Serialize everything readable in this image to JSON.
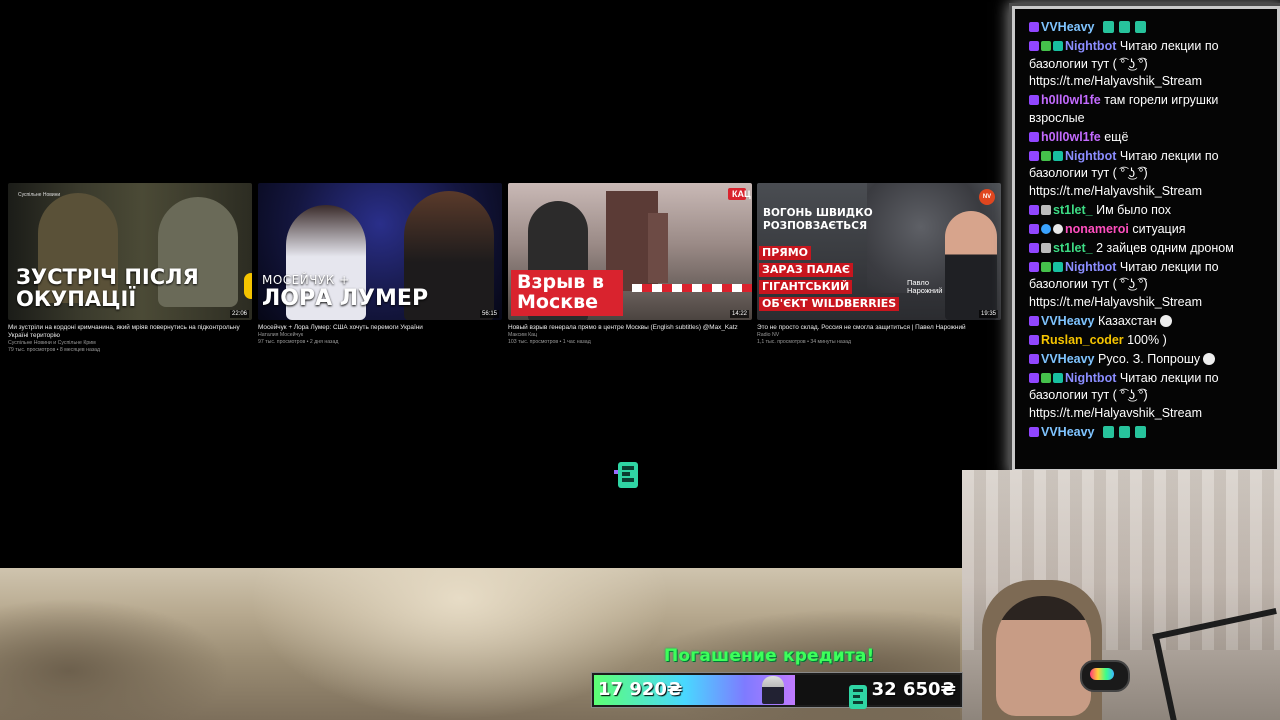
{
  "videos": [
    {
      "thumb_text": "ЗУСТРІЧ ПІСЛЯ ОКУПАЦІЇ",
      "thumb_logo": "Суспільне Новини",
      "duration": "22:06",
      "title": "Ми зустріли на кордоні кримчанина, який мріяв повернутись на підконтрольну Україні територію",
      "channel": "Суспільне Новини и Суспільне Крим",
      "meta": "79 тыс. просмотров • 8 месяцев назад"
    },
    {
      "thumb_sub": "МОСЕЙЧУК +",
      "thumb_text": "ЛОРА ЛУМЕР",
      "duration": "56:15",
      "title": "Мосейчук + Лора Лумер: США хочуть перемоги України",
      "channel": "Наталия Мосейчук",
      "meta": "97 тыс. просмотров • 2 дня назад"
    },
    {
      "thumb_badge": "КАЦ",
      "thumb_text": "Взрыв в Москве",
      "duration": "14:22",
      "title": "Новый взрыв генерала прямо в центре Москвы (English subtitles) @Max_Katz",
      "channel": "Максим Кац",
      "meta": "103 тыс. просмотров • 1 час назад"
    },
    {
      "thumb_badge": "NV",
      "thumb_heading": "ВОГОНЬ ШВИДКО РОЗПОВЗАЄТЬСЯ",
      "thumb_red_lines": [
        "ПРЯМО",
        "ЗАРАЗ ПАЛАЄ",
        "ГІГАНТСЬКИЙ",
        "ОБ'ЄКТ WILDBERRIES"
      ],
      "thumb_name": "Павло Нарожний",
      "duration": "19:35",
      "title": "Это не просто склад. Россия не смогла защититься | Павел Нарожний",
      "channel": "Radio NV",
      "meta": "1,1 тыс. просмотров • 34 минуты назад"
    }
  ],
  "chat": {
    "messages": [
      {
        "badges": [
          "tw"
        ],
        "user": "VVHeavy",
        "color": "#7fc4ff",
        "text": "",
        "emotes": 3
      },
      {
        "badges": [
          "tw",
          "pen",
          "bot"
        ],
        "user": "Nightbot",
        "color": "#8b8dff",
        "text": "Читаю лекции по базологии тут ( ͡° ͜ʖ ͡°) https://t.me/Halyavshik_Stream"
      },
      {
        "badges": [
          "tw"
        ],
        "user": "h0ll0wl1fe",
        "color": "#c36bff",
        "text": "там горели игрушки взрослые"
      },
      {
        "badges": [
          "tw"
        ],
        "user": "h0ll0wl1fe",
        "color": "#c36bff",
        "text": "ещё"
      },
      {
        "badges": [
          "tw",
          "pen",
          "bot"
        ],
        "user": "Nightbot",
        "color": "#8b8dff",
        "text": "Читаю лекции по базологии тут ( ͡° ͜ʖ ͡°) https://t.me/Halyavshik_Stream"
      },
      {
        "badges": [
          "tw",
          "spk"
        ],
        "user": "st1let_",
        "color": "#3ddc84",
        "text": "Им было пох"
      },
      {
        "badges": [
          "tw",
          "blu",
          "hand"
        ],
        "user": "nonameroi",
        "color": "#ff4fbf",
        "text": "ситуация"
      },
      {
        "badges": [
          "tw",
          "spk"
        ],
        "user": "st1let_",
        "color": "#3ddc84",
        "text": "2 зайцев одним дроном"
      },
      {
        "badges": [
          "tw",
          "pen",
          "bot"
        ],
        "user": "Nightbot",
        "color": "#8b8dff",
        "text": "Читаю лекции по базологии тут ( ͡° ͜ʖ ͡°) https://t.me/Halyavshik_Stream"
      },
      {
        "badges": [
          "tw"
        ],
        "user": "VVHeavy",
        "color": "#7fc4ff",
        "text": "Казахстан",
        "skull": true
      },
      {
        "badges": [
          "tw"
        ],
        "user": "Ruslan_coder",
        "color": "#f5c400",
        "text": "100% )"
      },
      {
        "badges": [
          "tw"
        ],
        "user": "VVHeavy",
        "color": "#7fc4ff",
        "text": "Русо. З. Попрошу",
        "skull": true
      },
      {
        "badges": [
          "tw",
          "pen",
          "bot"
        ],
        "user": "Nightbot",
        "color": "#8b8dff",
        "text": "Читаю лекции по базологии тут ( ͡° ͜ʖ ͡°) https://t.me/Halyavshik_Stream"
      },
      {
        "badges": [
          "tw"
        ],
        "user": "VVHeavy",
        "color": "#7fc4ff",
        "text": "",
        "emotes": 3
      }
    ]
  },
  "credit": {
    "title": "Погашение кредита!",
    "current": "17 920₴",
    "target": "32 650₴",
    "progress_fraction": 0.55
  },
  "colors": {
    "accent_green": "#3dff5a",
    "twitch_purple": "#9146ff",
    "youtube_red": "#d9232e"
  }
}
